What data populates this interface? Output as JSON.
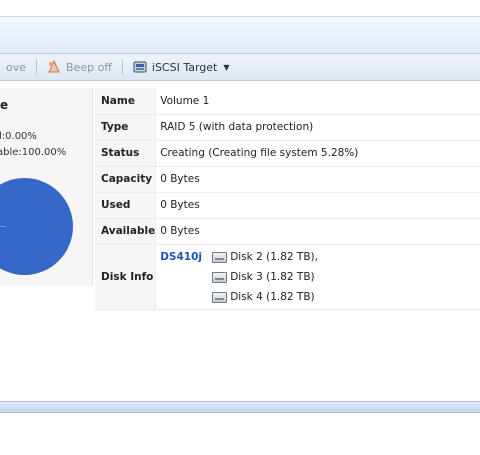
{
  "toolbar": {
    "remove_label": "ove",
    "beep_off_label": "Beep off",
    "iscsi_label": "iSCSI Target",
    "iscsi_icon": "iscsi-target-icon",
    "beep_icon": "beep-off-icon"
  },
  "left_panel": {
    "title": "e",
    "used_line": "l:0.00%",
    "available_line": "able:100.00%"
  },
  "details": {
    "name_label": "Name",
    "name_value": "Volume 1",
    "type_label": "Type",
    "type_value": "RAID 5 (with data protection)",
    "status_label": "Status",
    "status_value": "Creating (Creating file system 5.28%)",
    "capacity_label": "Capacity",
    "capacity_value": "0 Bytes",
    "used_label": "Used",
    "used_value": "0 Bytes",
    "available_label": "Available",
    "available_value": "0 Bytes",
    "diskinfo_label": "Disk Info",
    "nas_name": "DS410j",
    "disks": [
      "Disk 2 (1.82 TB),",
      "Disk 3 (1.82 TB)",
      "Disk 4 (1.82 TB)"
    ]
  },
  "colors": {
    "pie_available": "#3567c8",
    "status_link": "#2348a8",
    "nas_link": "#1d53b5"
  }
}
